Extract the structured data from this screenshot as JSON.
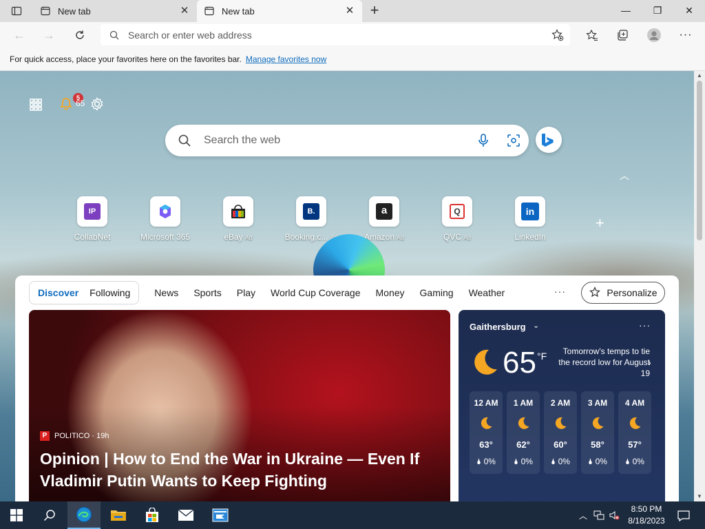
{
  "tabs": [
    {
      "title": "New tab",
      "active": false
    },
    {
      "title": "New tab",
      "active": true
    }
  ],
  "window_controls": {
    "minimize": "—",
    "restore": "❐",
    "close": "✕"
  },
  "toolbar": {
    "address_placeholder": "Search or enter web address"
  },
  "favorites_bar": {
    "message": "For quick access, place your favorites here on the favorites bar.",
    "link": "Manage favorites now"
  },
  "ntp": {
    "notification_count": "5",
    "mini_temp": "65",
    "search_placeholder": "Search the web",
    "quick_links": [
      {
        "label": "CollabNet",
        "ad": "",
        "icon": "collabnet-icon",
        "bg": "#7b3fbf",
        "text": "IP"
      },
      {
        "label": "Microsoft 365",
        "ad": "",
        "icon": "microsoft365-icon",
        "bg": "#5a6cf0",
        "text": ""
      },
      {
        "label": "eBay",
        "ad": "Ad",
        "icon": "ebay-icon",
        "bg": "#ffffff",
        "text": ""
      },
      {
        "label": "Booking.c...",
        "ad": "Ad",
        "icon": "booking-icon",
        "bg": "#003580",
        "text": "B."
      },
      {
        "label": "Amazon",
        "ad": "Ad",
        "icon": "amazon-icon",
        "bg": "#222222",
        "text": "a"
      },
      {
        "label": "QVC",
        "ad": "Ad",
        "icon": "qvc-icon",
        "bg": "#ffffff",
        "text": "Q"
      },
      {
        "label": "LinkedIn",
        "ad": "",
        "icon": "linkedin-icon",
        "bg": "#0a66c2",
        "text": "in"
      }
    ],
    "feed_pill": [
      "Discover",
      "Following"
    ],
    "feed_nav": [
      "News",
      "Sports",
      "Play",
      "World Cup Coverage",
      "Money",
      "Gaming",
      "Weather"
    ],
    "more": "···",
    "personalize": "Personalize",
    "hero": {
      "source": "POLITICO · 19h",
      "headline": "Opinion | How to End the War in Ukraine — Even If Vladimir Putin Wants to Keep Fighting"
    },
    "weather": {
      "location": "Gaithersburg",
      "temp": "65",
      "unit": "°F",
      "note": "Tomorrow's temps to tie the record low for August 19",
      "hourly": [
        {
          "time": "12 AM",
          "temp": "63°",
          "precip": "0%"
        },
        {
          "time": "1 AM",
          "temp": "62°",
          "precip": "0%"
        },
        {
          "time": "2 AM",
          "temp": "60°",
          "precip": "0%"
        },
        {
          "time": "3 AM",
          "temp": "58°",
          "precip": "0%"
        },
        {
          "time": "4 AM",
          "temp": "57°",
          "precip": "0%"
        }
      ]
    }
  },
  "taskbar": {
    "time": "8:50 PM",
    "date": "8/18/2023"
  },
  "colors": {
    "accent": "#0f6cbd",
    "taskbar": "#1c2a3e",
    "weather_bg": "#1c2b4e"
  }
}
